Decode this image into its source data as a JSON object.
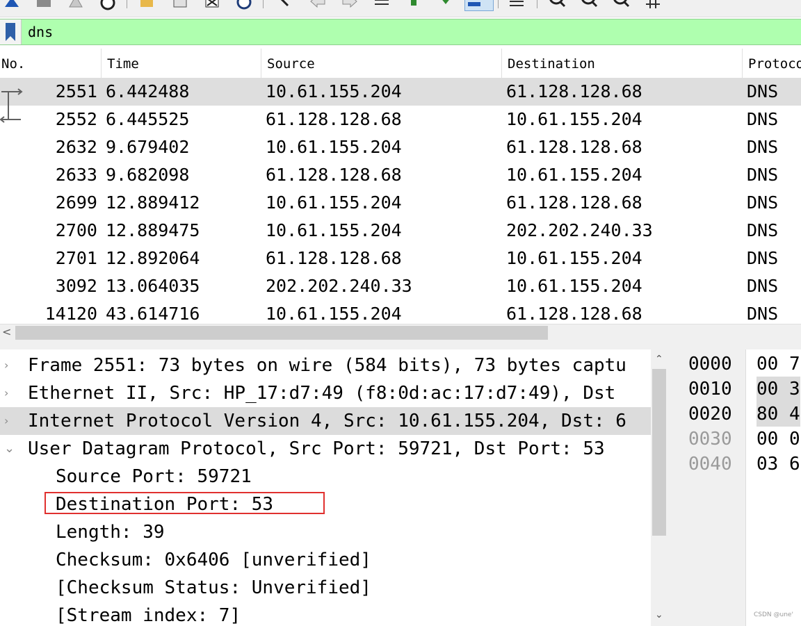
{
  "filter": {
    "value": "dns"
  },
  "packet_list": {
    "columns": [
      "No.",
      "Time",
      "Source",
      "Destination",
      "Protoco"
    ],
    "rows": [
      {
        "no": "2551",
        "time": "6.442488",
        "source": "10.61.155.204",
        "destination": "61.128.128.68",
        "protocol": "DNS"
      },
      {
        "no": "2552",
        "time": "6.445525",
        "source": "61.128.128.68",
        "destination": "10.61.155.204",
        "protocol": "DNS"
      },
      {
        "no": "2632",
        "time": "9.679402",
        "source": "10.61.155.204",
        "destination": "61.128.128.68",
        "protocol": "DNS"
      },
      {
        "no": "2633",
        "time": "9.682098",
        "source": "61.128.128.68",
        "destination": "10.61.155.204",
        "protocol": "DNS"
      },
      {
        "no": "2699",
        "time": "12.889412",
        "source": "10.61.155.204",
        "destination": "61.128.128.68",
        "protocol": "DNS"
      },
      {
        "no": "2700",
        "time": "12.889475",
        "source": "10.61.155.204",
        "destination": "202.202.240.33",
        "protocol": "DNS"
      },
      {
        "no": "2701",
        "time": "12.892064",
        "source": "61.128.128.68",
        "destination": "10.61.155.204",
        "protocol": "DNS"
      },
      {
        "no": "3092",
        "time": "13.064035",
        "source": "202.202.240.33",
        "destination": "10.61.155.204",
        "protocol": "DNS"
      },
      {
        "no": "14120",
        "time": "43.614716",
        "source": "10.61.155.204",
        "destination": "61.128.128.68",
        "protocol": "DNS"
      }
    ]
  },
  "details": {
    "items": [
      {
        "text": "Frame 2551: 73 bytes on wire (584 bits), 73 bytes captu",
        "expanded": false
      },
      {
        "text": "Ethernet II, Src: HP_17:d7:49 (f8:0d:ac:17:d7:49), Dst",
        "expanded": false
      },
      {
        "text": "Internet Protocol Version 4, Src: 10.61.155.204, Dst: 6",
        "expanded": false
      },
      {
        "text": "User Datagram Protocol, Src Port: 59721, Dst Port: 53",
        "expanded": true
      }
    ],
    "udp_fields": [
      "Source Port: 59721",
      "Destination Port: 53",
      "Length: 39",
      "Checksum: 0x6406 [unverified]",
      "[Checksum Status: Unverified]",
      "[Stream index: 7]"
    ]
  },
  "bytes": {
    "offsets": [
      "0000",
      "0010",
      "0020",
      "0030",
      "0040"
    ],
    "hex": [
      "00 7",
      "00 3",
      "80 4",
      "00 0",
      "03 6"
    ]
  },
  "watermark": "CSDN @une'"
}
